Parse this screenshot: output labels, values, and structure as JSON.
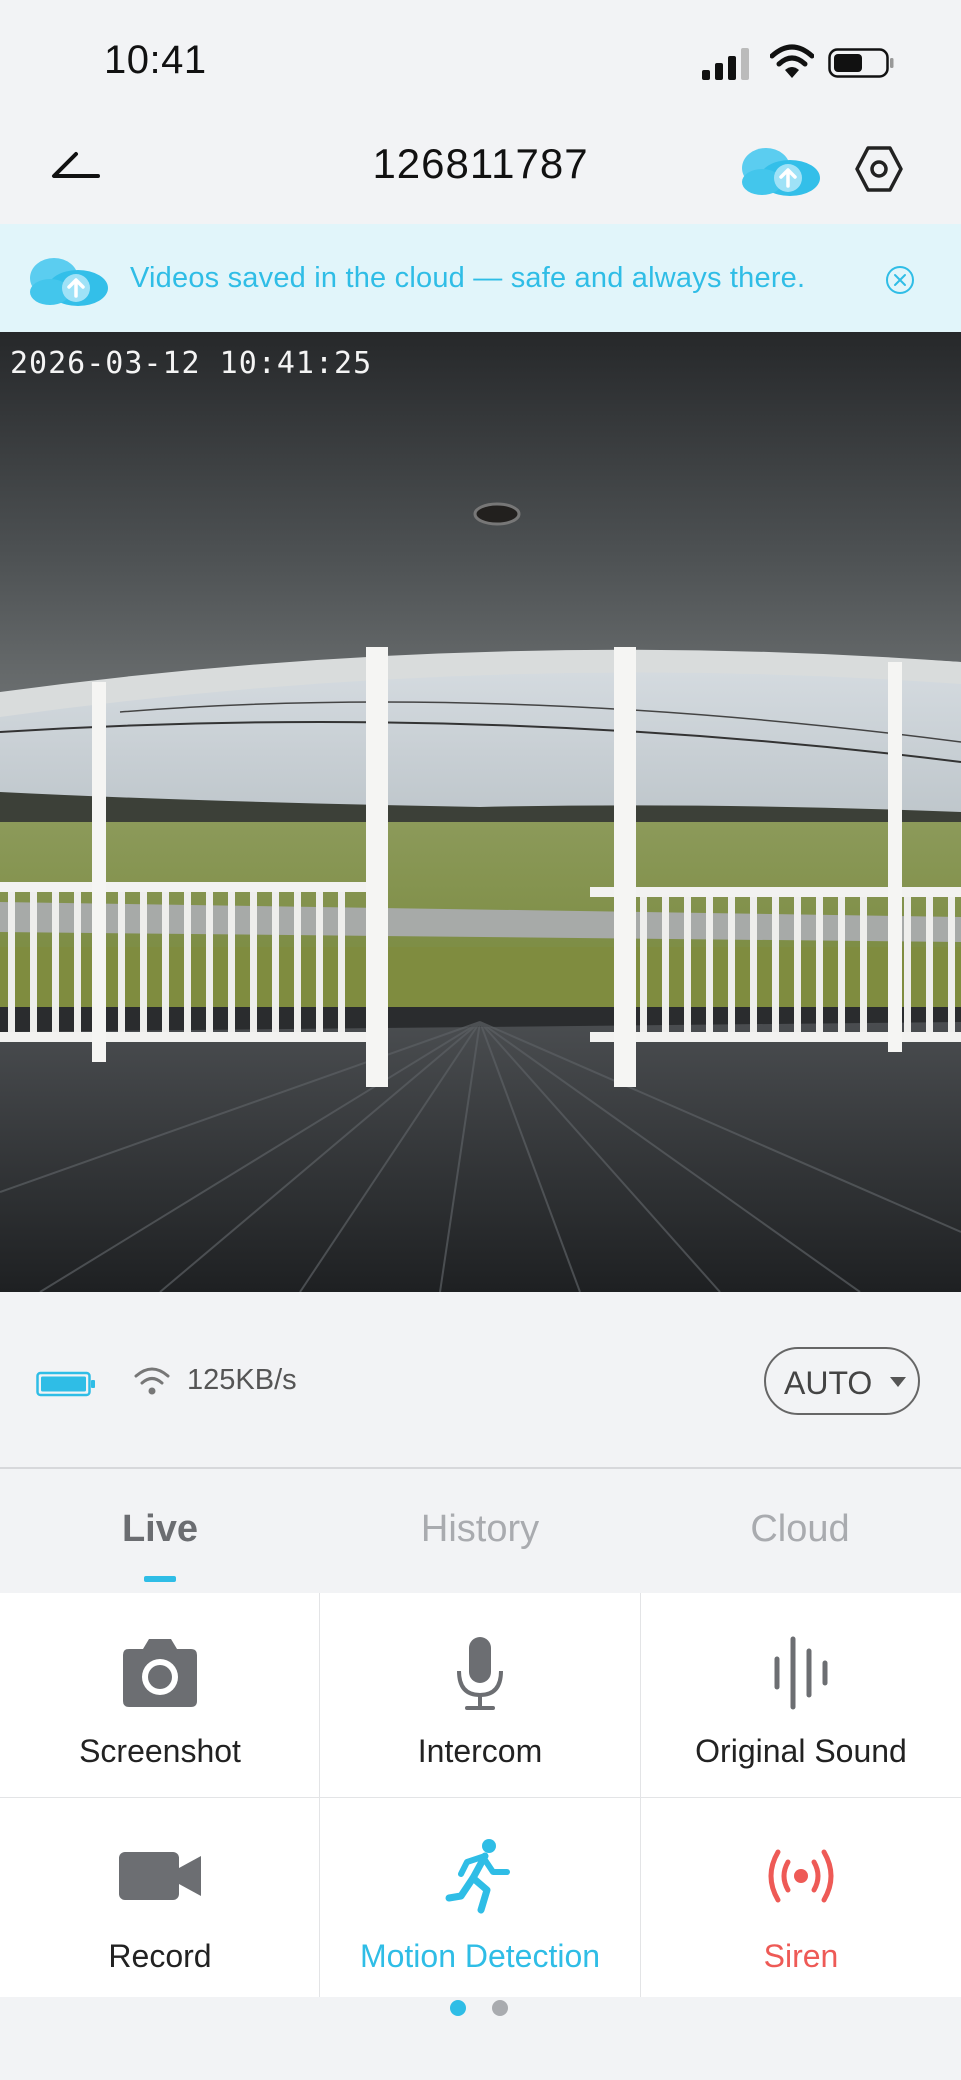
{
  "status_bar": {
    "time": "10:41"
  },
  "nav": {
    "title": "126811787"
  },
  "banner": {
    "text": "Videos saved in the cloud — safe and always there."
  },
  "video": {
    "timestamp": "2026-03-12  10:41:25"
  },
  "info": {
    "speed": "125KB/s",
    "quality": "AUTO"
  },
  "tabs": [
    {
      "label": "Live",
      "active": true
    },
    {
      "label": "History",
      "active": false
    },
    {
      "label": "Cloud",
      "active": false
    }
  ],
  "controls": [
    {
      "label": "Screenshot",
      "icon": "camera-icon"
    },
    {
      "label": "Intercom",
      "icon": "microphone-icon"
    },
    {
      "label": "Original Sound",
      "icon": "sound-wave-icon"
    },
    {
      "label": "Record",
      "icon": "video-camera-icon"
    },
    {
      "label": "Motion Detection",
      "icon": "running-person-icon"
    },
    {
      "label": "Siren",
      "icon": "siren-icon"
    }
  ],
  "pager": {
    "page": 1,
    "total": 2
  },
  "colors": {
    "accent": "#2fbde6",
    "danger": "#ee5a56",
    "banner_bg": "#e1f5fa"
  }
}
